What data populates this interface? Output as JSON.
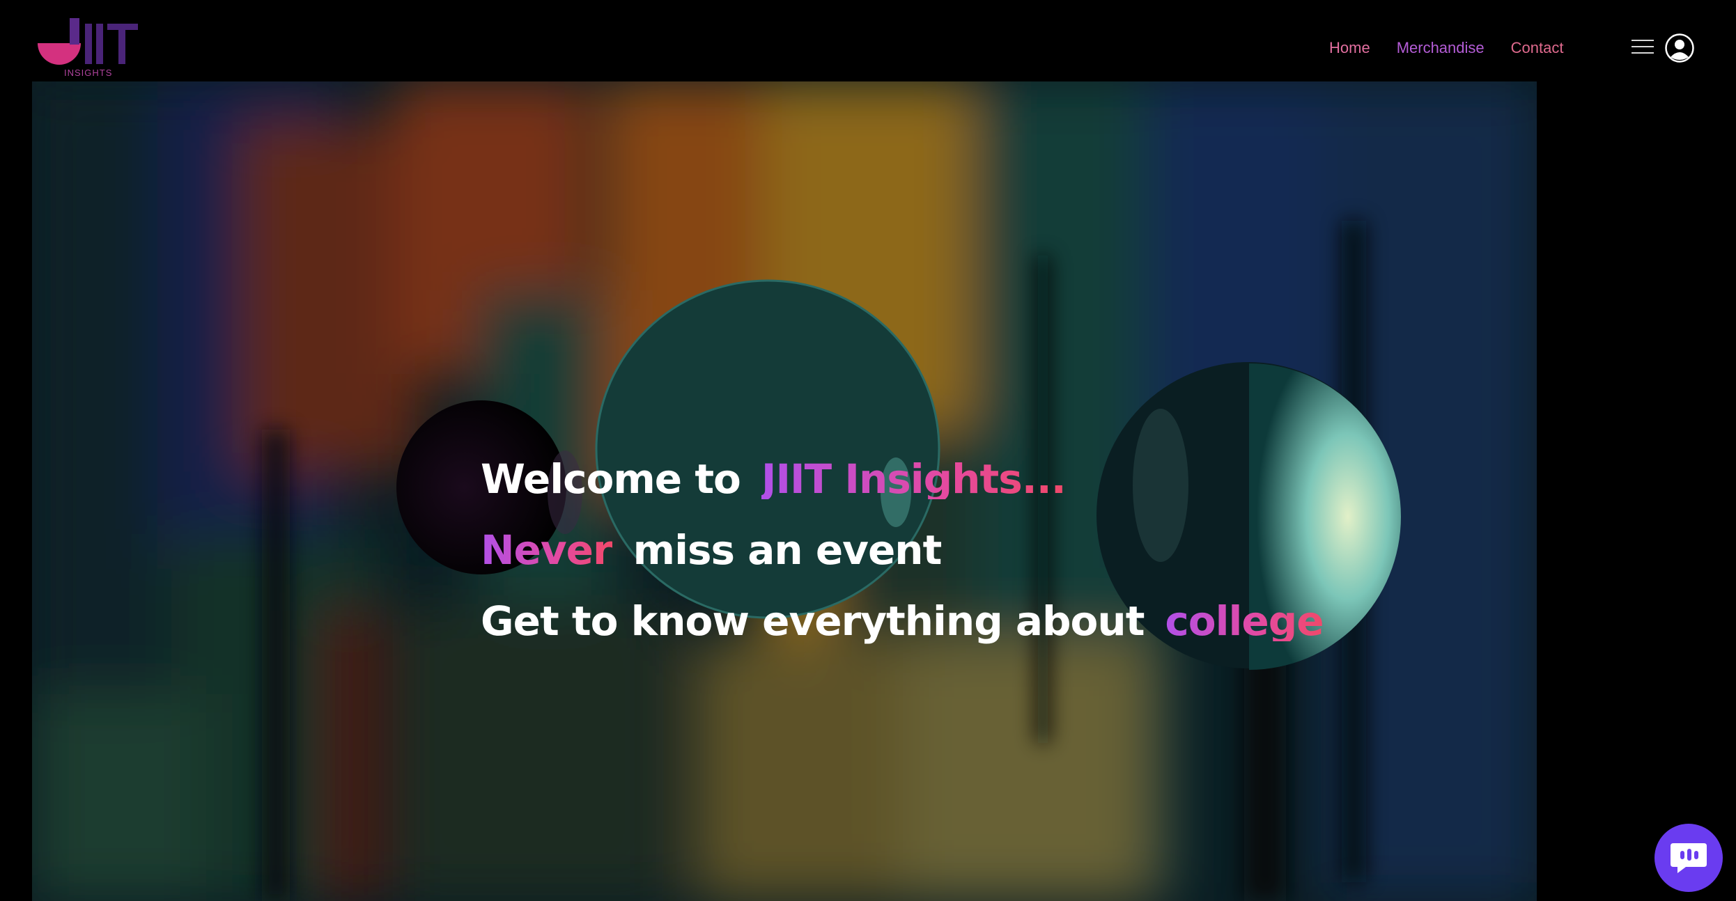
{
  "brand": {
    "logo_text": "JIIT",
    "logo_caption": "INSIGHTS"
  },
  "nav": {
    "items": [
      {
        "label": "Home"
      },
      {
        "label": "Merchandise"
      },
      {
        "label": "Contact"
      }
    ]
  },
  "icons": {
    "menu": "hamburger-menu-icon",
    "account": "user-avatar-icon",
    "chat": "chat-bubble-icon"
  },
  "hero": {
    "line1_prefix": "Welcome to",
    "line1_highlight": "JIIT Insights...",
    "line2_highlight": "Never",
    "line2_suffix": "miss an event",
    "line3_prefix": "Get to know everything about",
    "line3_highlight": "college"
  },
  "colors": {
    "background": "#000000",
    "accent_purple": "#b150e8",
    "accent_pink": "#e44aa0",
    "accent_red": "#f0496a",
    "chat_button": "#6a3cf0"
  }
}
